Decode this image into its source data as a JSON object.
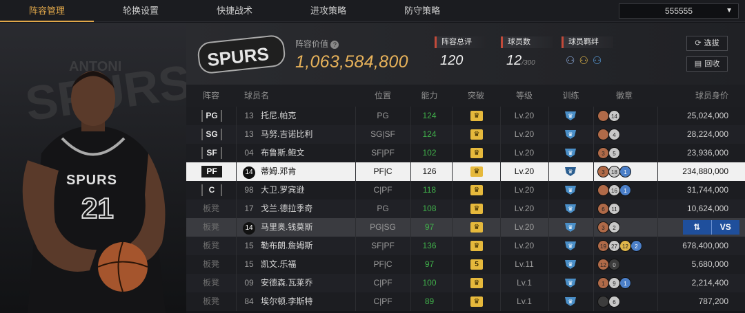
{
  "nav": {
    "tabs": [
      "阵容管理",
      "轮换设置",
      "快捷战术",
      "进攻策略",
      "防守策略"
    ],
    "active_tab": 0,
    "server_select": "555555"
  },
  "team": {
    "value_label": "阵容价值",
    "value": "1,063,584,800",
    "rating_label": "阵容总评",
    "rating": "120",
    "players_label": "球员数",
    "players_count": "12",
    "players_max": "/300",
    "chemistry_label": "球员羁绊",
    "btn_select": "选拔",
    "btn_recycle": "回收"
  },
  "player_card": {
    "jersey_text": "SPURS",
    "jersey_number": "21"
  },
  "table": {
    "headers": [
      "阵容",
      "球员名",
      "位置",
      "能力",
      "突破",
      "等级",
      "训练",
      "徽章",
      "球员身价"
    ],
    "rows": [
      {
        "slot": "PG",
        "num": "13",
        "name": "托尼.帕克",
        "pos": "PG",
        "ovr": "124",
        "break": "crown",
        "level": "Lv.20",
        "badges": [
          [
            "bronze",
            ""
          ],
          [
            "silver",
            "14"
          ]
        ],
        "value": "25,024,000"
      },
      {
        "slot": "SG",
        "num": "13",
        "name": "马努.吉诺比利",
        "pos": "SG|SF",
        "ovr": "124",
        "break": "crown",
        "level": "Lv.20",
        "badges": [
          [
            "bronze",
            ""
          ],
          [
            "silver",
            "4"
          ]
        ],
        "value": "28,224,000"
      },
      {
        "slot": "SF",
        "num": "04",
        "name": "布鲁斯.鲍文",
        "pos": "SF|PF",
        "ovr": "102",
        "break": "crown",
        "level": "Lv.20",
        "badges": [
          [
            "bronze",
            "3"
          ],
          [
            "silver",
            "5"
          ]
        ],
        "value": "23,936,000"
      },
      {
        "slot": "PF",
        "num": "14",
        "name": "蒂姆.邓肯",
        "pos": "PF|C",
        "ovr": "126",
        "break": "crown",
        "level": "Lv.20",
        "badges": [
          [
            "bronze",
            "3"
          ],
          [
            "silver",
            "18"
          ],
          [
            "blue",
            "1"
          ]
        ],
        "value": "234,880,000"
      },
      {
        "slot": "C",
        "num": "98",
        "name": "大卫.罗宾逊",
        "pos": "C|PF",
        "ovr": "118",
        "break": "crown",
        "level": "Lv.20",
        "badges": [
          [
            "bronze",
            ""
          ],
          [
            "silver",
            "16"
          ],
          [
            "blue",
            "1"
          ]
        ],
        "value": "31,744,000"
      },
      {
        "slot": "板凳",
        "num": "17",
        "name": "戈兰.德拉季奇",
        "pos": "PG",
        "ovr": "108",
        "break": "crown",
        "level": "Lv.20",
        "badges": [
          [
            "bronze",
            "6"
          ],
          [
            "silver",
            "11"
          ]
        ],
        "value": "10,624,000"
      },
      {
        "slot": "板凳",
        "num": "14",
        "name": "马里奥.钱莫斯",
        "pos": "PG|SG",
        "ovr": "97",
        "break": "crown",
        "level": "Lv.20",
        "badges": [
          [
            "bronze",
            "3"
          ],
          [
            "silver",
            "2"
          ]
        ],
        "value": ""
      },
      {
        "slot": "板凳",
        "num": "15",
        "name": "勒布朗.詹姆斯",
        "pos": "SF|PF",
        "ovr": "136",
        "break": "crown",
        "level": "Lv.20",
        "badges": [
          [
            "bronze",
            "19"
          ],
          [
            "silver",
            "27"
          ],
          [
            "gold",
            "12"
          ],
          [
            "blue",
            "2"
          ]
        ],
        "value": "678,400,000"
      },
      {
        "slot": "板凳",
        "num": "15",
        "name": "凯文.乐福",
        "pos": "PF|C",
        "ovr": "97",
        "break": "5",
        "level": "Lv.11",
        "badges": [
          [
            "bronze",
            "12"
          ],
          [
            "dark",
            "0"
          ]
        ],
        "value": "5,680,000"
      },
      {
        "slot": "板凳",
        "num": "09",
        "name": "安德森.瓦莱乔",
        "pos": "C|PF",
        "ovr": "100",
        "break": "crown",
        "level": "Lv.1",
        "badges": [
          [
            "bronze",
            "1"
          ],
          [
            "silver",
            "9"
          ],
          [
            "blue",
            "1"
          ]
        ],
        "value": "2,214,400"
      },
      {
        "slot": "板凳",
        "num": "84",
        "name": "埃尔顿.李斯特",
        "pos": "C|PF",
        "ovr": "89",
        "break": "crown",
        "level": "Lv.1",
        "badges": [
          [
            "dark",
            ""
          ],
          [
            "silver",
            "6"
          ]
        ],
        "value": "787,200"
      }
    ],
    "selected_row": 3,
    "hover_row": 6,
    "swap_label": "VS"
  },
  "colors": {
    "accent": "#e2a84a",
    "green": "#40b04a",
    "swap_blue": "#1f4f9c"
  }
}
